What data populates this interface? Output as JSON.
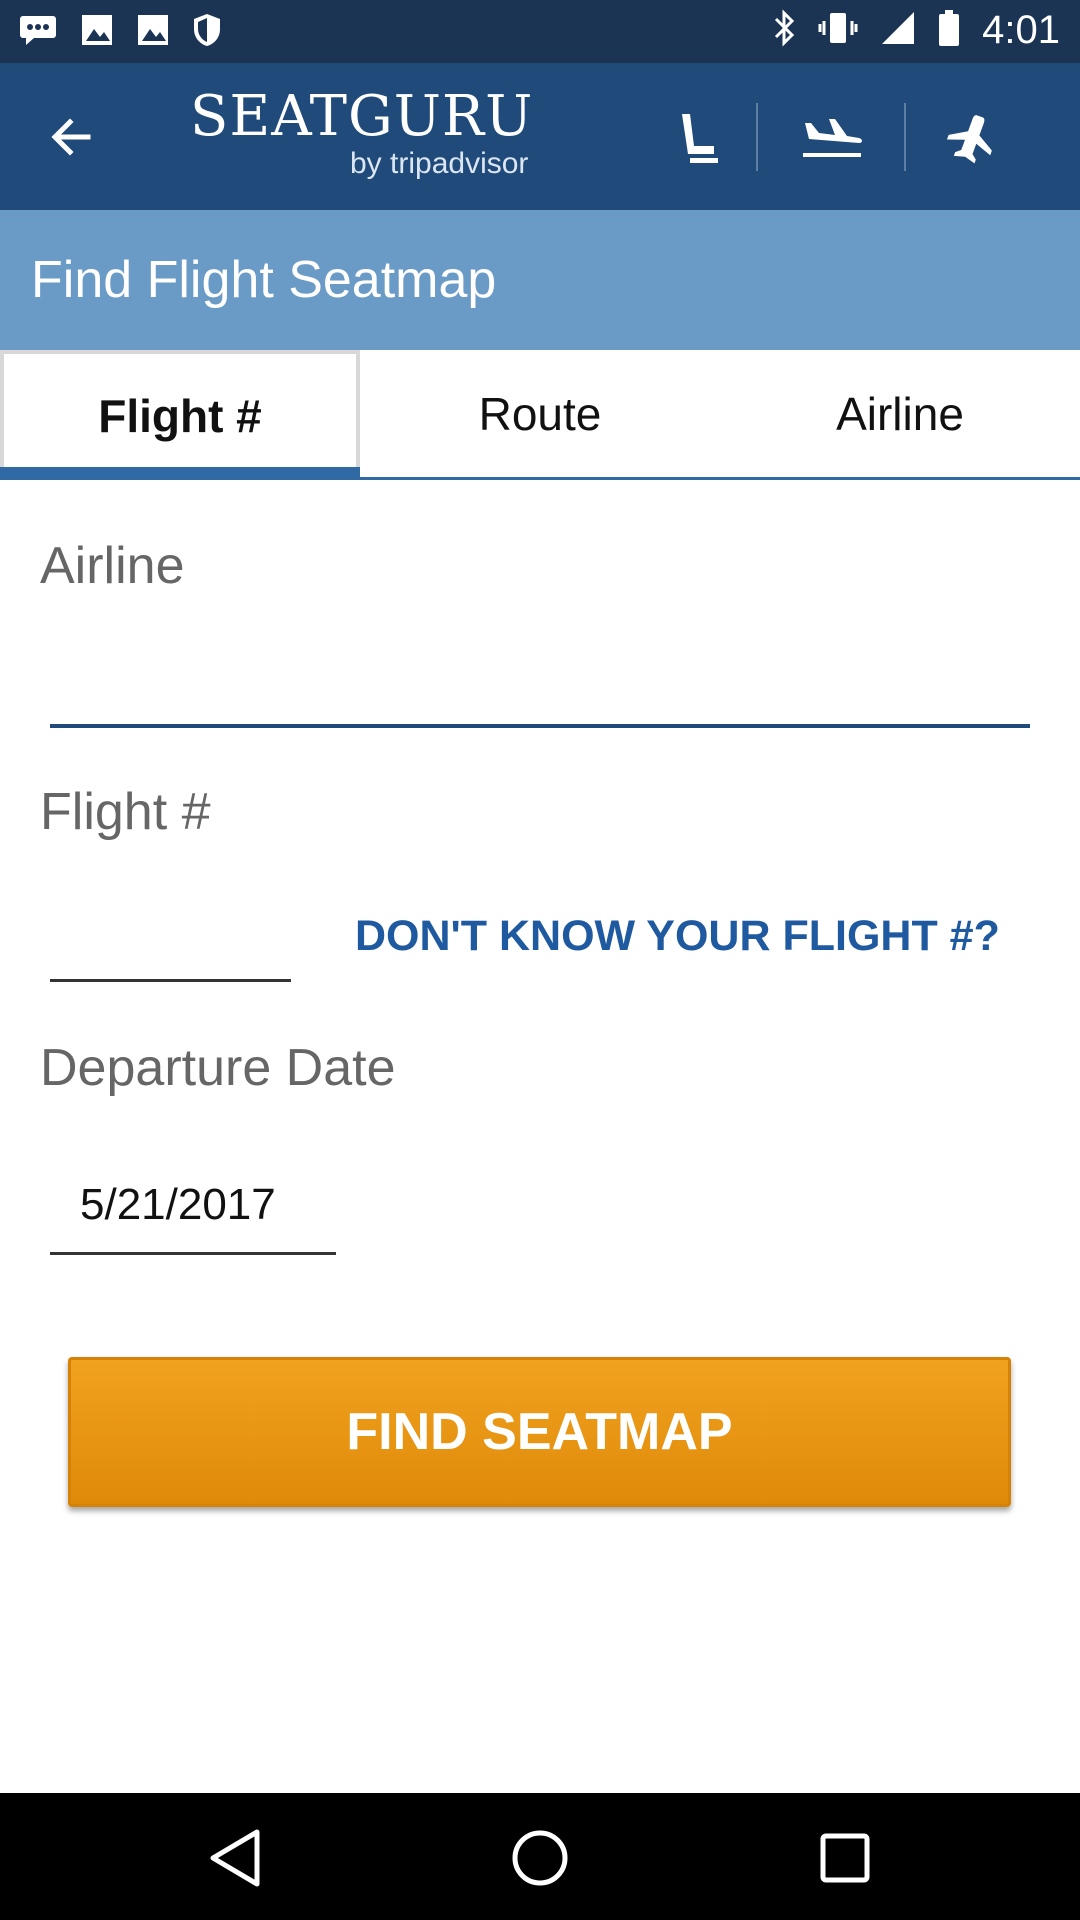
{
  "status_bar": {
    "time": "4:01",
    "icons": [
      "message-icon",
      "image-icon",
      "image-icon",
      "shield-icon",
      "bluetooth-icon",
      "vibrate-icon",
      "signal-icon",
      "battery-icon"
    ]
  },
  "app_bar": {
    "logo_main": "SEATGURU",
    "logo_sub": "by tripadvisor",
    "nav_icons": [
      "seat-icon",
      "arrivals-icon",
      "airplane-icon"
    ]
  },
  "page": {
    "title": "Find Flight Seatmap"
  },
  "tabs": [
    {
      "label": "Flight #",
      "active": true
    },
    {
      "label": "Route",
      "active": false
    },
    {
      "label": "Airline",
      "active": false
    }
  ],
  "form": {
    "airline_label": "Airline",
    "airline_value": "",
    "flight_label": "Flight #",
    "flight_value": "",
    "dont_know_link": "DON'T KNOW YOUR FLIGHT #?",
    "departure_label": "Departure Date",
    "departure_value": "5/21/2017",
    "submit_label": "FIND SEATMAP"
  },
  "colors": {
    "status_bar": "#1b3454",
    "app_bar": "#1f4a7a",
    "title_band": "#6a9ac6",
    "accent_blue": "#2f6aa5",
    "button_orange": "#e8950f"
  }
}
